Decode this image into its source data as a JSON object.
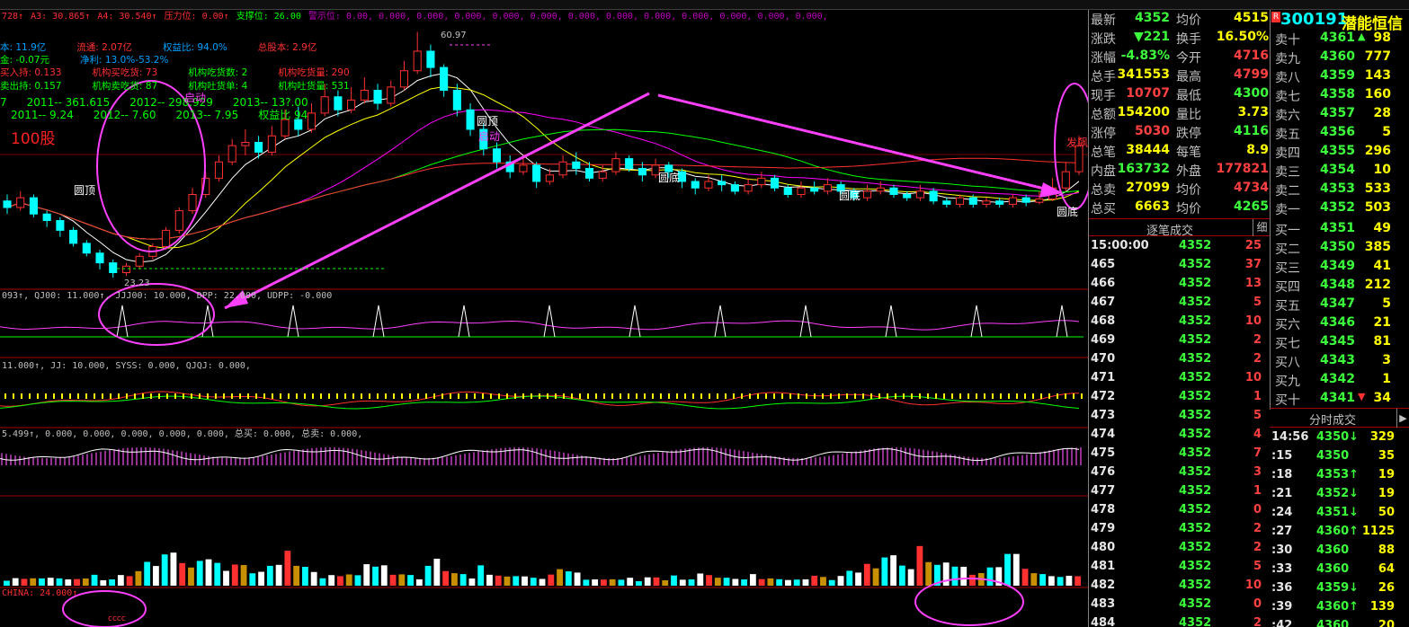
{
  "header_strip": {
    "items": [
      {
        "text": "728↑",
        "color": "#ff3030"
      },
      {
        "text": "A3: 30.865↑",
        "color": "#ff3030"
      },
      {
        "text": "A4: 30.540↑",
        "color": "#ff3030"
      },
      {
        "text": "压力位: 0.00↑",
        "color": "#ff3030"
      },
      {
        "text": "支撑位: 26.00",
        "color": "#00ff00"
      },
      {
        "text": "警示位: 0.00, 0.000, 0.000, 0.000, 0.000, 0.000, 0.000, 0.000, 0.000, 0.000, 0.000, 0.000, 0.000,",
        "color": "#c000c0"
      }
    ]
  },
  "info_overlay": {
    "r1": [
      {
        "text": "本: 11.9亿",
        "color": "#00a0ff"
      },
      {
        "text": "流通: 2.07亿",
        "color": "#ff3030"
      },
      {
        "text": "权益比: 94.0%",
        "color": "#00a0ff"
      },
      {
        "text": "总股本: 2.9亿",
        "color": "#ff3030"
      }
    ],
    "r2": [
      {
        "text": "金: -0.07元",
        "color": "#00ff00"
      },
      {
        "text": "净利: 13.0%-53.2%",
        "color": "#00a0ff"
      }
    ],
    "r3": [
      {
        "text": "买入持: 0.133",
        "color": "#ff3030"
      },
      {
        "text": "机构买吃货: 73",
        "color": "#ff3030"
      },
      {
        "text": "机构吃货数: 2",
        "color": "#00ff00"
      },
      {
        "text": "机构吃货量: 290",
        "color": "#ff3030"
      }
    ],
    "r4": [
      {
        "text": "卖出持: 0.157",
        "color": "#00ff00"
      },
      {
        "text": "机构卖吃货: 87",
        "color": "#00ff00"
      },
      {
        "text": "机构吐货单: 4",
        "color": "#00ff00"
      },
      {
        "text": "机构吐货量: 531",
        "color": "#00ff00"
      }
    ],
    "r5": [
      {
        "text": "7",
        "color": "#00ff00"
      },
      {
        "text": "2011-- 361.615",
        "color": "#00ff00"
      },
      {
        "text": "2012-- 298.929",
        "color": "#00ff00"
      },
      {
        "text": "2013-- 13?.00",
        "color": "#00ff00"
      }
    ],
    "r6": [
      {
        "text": "2011-- 9.24",
        "color": "#00ff00"
      },
      {
        "text": "2012-- 7.60",
        "color": "#00ff00"
      },
      {
        "text": "2013-- 7.95",
        "color": "#00ff00"
      },
      {
        "text": "权益比 94",
        "color": "#00ff00"
      }
    ],
    "big": {
      "text": "100股",
      "color": "#ff2020"
    },
    "peak_label": "60.97",
    "low_label": "23.23"
  },
  "price_annotations": {
    "arc_top": "圆顶",
    "arc_left": "圆顶",
    "arc_mid": "圆底",
    "arc_r1": "圆底",
    "arc_r2": "圆底",
    "start_left": "启动",
    "start_mid": "启动",
    "right_signal": "发飙"
  },
  "indicator_lines": {
    "ind1": "093↑, QJ00: 11.000↑, JJJ00: 10.000, DPP: 22.000, UDPP: -0.000",
    "ind2": "11.000↑, JJ: 10.000, SYSS: 0.000, QJQJ: 0.000,",
    "ind3": "5.499↑, 0.000, 0.000, 0.000, 0.000, 0.000, 总买: 0.000, 总卖: 0.000,",
    "ind4": "CHINA: 24.000↑",
    "ind4b": "cccc"
  },
  "quote": {
    "rows": [
      {
        "l1": "最新",
        "v1": "4352",
        "c1": "#3cff3c",
        "l2": "均价",
        "v2": "4515",
        "c2": "#ffff00"
      },
      {
        "l1": "涨跌",
        "v1": "▼221",
        "c1": "#3cff3c",
        "l2": "换手",
        "v2": "16.50%",
        "c2": "#ffff00"
      },
      {
        "l1": "涨幅",
        "v1": "-4.83%",
        "c1": "#3cff3c",
        "l2": "今开",
        "v2": "4716",
        "c2": "#ff4040"
      },
      {
        "l1": "总手",
        "v1": "341553",
        "c1": "#ffff00",
        "l2": "最高",
        "v2": "4799",
        "c2": "#ff4040"
      },
      {
        "l1": "现手",
        "v1": "10707",
        "c1": "#ff4040",
        "l2": "最低",
        "v2": "4300",
        "c2": "#3cff3c"
      },
      {
        "l1": "总额",
        "v1": "154200",
        "c1": "#ffff00",
        "l2": "量比",
        "v2": "3.73",
        "c2": "#ffff00"
      },
      {
        "l1": "涨停",
        "v1": "5030",
        "c1": "#ff4040",
        "l2": "跌停",
        "v2": "4116",
        "c2": "#3cff3c"
      },
      {
        "l1": "总笔",
        "v1": "38444",
        "c1": "#ffff00",
        "l2": "每笔",
        "v2": "8.9",
        "c2": "#ffff00"
      },
      {
        "l1": "内盘",
        "v1": "163732",
        "c1": "#3cff3c",
        "l2": "外盘",
        "v2": "177821",
        "c2": "#ff4040"
      },
      {
        "l1": "总卖",
        "v1": "27099",
        "c1": "#ffff00",
        "l2": "均价",
        "v2": "4734",
        "c2": "#ff4040"
      },
      {
        "l1": "总买",
        "v1": "6663",
        "c1": "#ffff00",
        "l2": "均价",
        "v2": "4265",
        "c2": "#3cff3c"
      }
    ]
  },
  "stock": {
    "code": "300191",
    "name": "潜能恒信",
    "badge": "R"
  },
  "order_book": {
    "rows": [
      {
        "label": "卖十",
        "price": "4361",
        "vol": "98",
        "color": "#3cff3c",
        "arrow": "▲"
      },
      {
        "label": "卖九",
        "price": "4360",
        "vol": "777",
        "color": "#3cff3c",
        "arrow": ""
      },
      {
        "label": "卖八",
        "price": "4359",
        "vol": "143",
        "color": "#3cff3c",
        "arrow": ""
      },
      {
        "label": "卖七",
        "price": "4358",
        "vol": "160",
        "color": "#3cff3c",
        "arrow": ""
      },
      {
        "label": "卖六",
        "price": "4357",
        "vol": "28",
        "color": "#3cff3c",
        "arrow": ""
      },
      {
        "label": "卖五",
        "price": "4356",
        "vol": "5",
        "color": "#3cff3c",
        "arrow": ""
      },
      {
        "label": "卖四",
        "price": "4355",
        "vol": "296",
        "color": "#3cff3c",
        "arrow": ""
      },
      {
        "label": "卖三",
        "price": "4354",
        "vol": "10",
        "color": "#3cff3c",
        "arrow": ""
      },
      {
        "label": "卖二",
        "price": "4353",
        "vol": "533",
        "color": "#3cff3c",
        "arrow": ""
      },
      {
        "label": "卖一",
        "price": "4352",
        "vol": "503",
        "color": "#3cff3c",
        "arrow": ""
      },
      {
        "label": "买一",
        "price": "4351",
        "vol": "49",
        "color": "#3cff3c",
        "arrow": ""
      },
      {
        "label": "买二",
        "price": "4350",
        "vol": "385",
        "color": "#3cff3c",
        "arrow": ""
      },
      {
        "label": "买三",
        "price": "4349",
        "vol": "41",
        "color": "#3cff3c",
        "arrow": ""
      },
      {
        "label": "买四",
        "price": "4348",
        "vol": "212",
        "color": "#3cff3c",
        "arrow": ""
      },
      {
        "label": "买五",
        "price": "4347",
        "vol": "5",
        "color": "#3cff3c",
        "arrow": ""
      },
      {
        "label": "买六",
        "price": "4346",
        "vol": "21",
        "color": "#3cff3c",
        "arrow": ""
      },
      {
        "label": "买七",
        "price": "4345",
        "vol": "81",
        "color": "#3cff3c",
        "arrow": ""
      },
      {
        "label": "买八",
        "price": "4343",
        "vol": "3",
        "color": "#3cff3c",
        "arrow": ""
      },
      {
        "label": "买九",
        "price": "4342",
        "vol": "1",
        "color": "#3cff3c",
        "arrow": ""
      },
      {
        "label": "买十",
        "price": "4341",
        "vol": "34",
        "color": "#3cff3c",
        "arrow": "▼"
      }
    ]
  },
  "tick_panel": {
    "title": "逐笔成交",
    "btn": "细",
    "rows": [
      {
        "seq": "15:00:00",
        "price": "4352",
        "vol": "25"
      },
      {
        "seq": "465",
        "price": "4352",
        "vol": "37"
      },
      {
        "seq": "466",
        "price": "4352",
        "vol": "13"
      },
      {
        "seq": "467",
        "price": "4352",
        "vol": "5"
      },
      {
        "seq": "468",
        "price": "4352",
        "vol": "10"
      },
      {
        "seq": "469",
        "price": "4352",
        "vol": "2"
      },
      {
        "seq": "470",
        "price": "4352",
        "vol": "2"
      },
      {
        "seq": "471",
        "price": "4352",
        "vol": "10"
      },
      {
        "seq": "472",
        "price": "4352",
        "vol": "1"
      },
      {
        "seq": "473",
        "price": "4352",
        "vol": "5"
      },
      {
        "seq": "474",
        "price": "4352",
        "vol": "4"
      },
      {
        "seq": "475",
        "price": "4352",
        "vol": "7"
      },
      {
        "seq": "476",
        "price": "4352",
        "vol": "3"
      },
      {
        "seq": "477",
        "price": "4352",
        "vol": "1"
      },
      {
        "seq": "478",
        "price": "4352",
        "vol": "0"
      },
      {
        "seq": "479",
        "price": "4352",
        "vol": "2"
      },
      {
        "seq": "480",
        "price": "4352",
        "vol": "2"
      },
      {
        "seq": "481",
        "price": "4352",
        "vol": "5"
      },
      {
        "seq": "482",
        "price": "4352",
        "vol": "10"
      },
      {
        "seq": "483",
        "price": "4352",
        "vol": "0"
      },
      {
        "seq": "484",
        "price": "4352",
        "vol": "2"
      }
    ]
  },
  "trade_panel": {
    "title": "分时成交",
    "btn": "▶",
    "rows": [
      {
        "time": "14:56",
        "price": "4350",
        "arrow": "↓",
        "vol": "329"
      },
      {
        "time": ":15",
        "price": "4350",
        "arrow": "",
        "vol": "35"
      },
      {
        "time": ":18",
        "price": "4353",
        "arrow": "↑",
        "vol": "19"
      },
      {
        "time": ":21",
        "price": "4352",
        "arrow": "↓",
        "vol": "19"
      },
      {
        "time": ":24",
        "price": "4351",
        "arrow": "↓",
        "vol": "50"
      },
      {
        "time": ":27",
        "price": "4360",
        "arrow": "↑",
        "vol": "1125"
      },
      {
        "time": ":30",
        "price": "4360",
        "arrow": "",
        "vol": "88"
      },
      {
        "time": ":33",
        "price": "4360",
        "arrow": "",
        "vol": "64"
      },
      {
        "time": ":36",
        "price": "4359",
        "arrow": "↓",
        "vol": "26"
      },
      {
        "time": ":39",
        "price": "4360",
        "arrow": "↑",
        "vol": "139"
      },
      {
        "time": ":42",
        "price": "4360",
        "arrow": "",
        "vol": "20"
      }
    ]
  },
  "colors": {
    "up": "#ff3030",
    "down": "#00ffff",
    "ma5": "#ffffff",
    "ma10": "#ffff00",
    "ma20": "#ff00ff",
    "ma30": "#00ff00",
    "ma60": "#ff3030",
    "annotation": "#ff40ff",
    "divider": "#a00000"
  },
  "chart_data": {
    "type": "candlestick",
    "price_ylim": [
      22,
      62
    ],
    "candles": [
      {
        "o": 35.0,
        "c": 34.0,
        "h": 36.0,
        "l": 33.0
      },
      {
        "o": 34.0,
        "c": 35.5,
        "h": 36.5,
        "l": 33.5
      },
      {
        "o": 35.5,
        "c": 33.0,
        "h": 36.0,
        "l": 32.5
      },
      {
        "o": 33.0,
        "c": 32.0,
        "h": 33.5,
        "l": 31.0
      },
      {
        "o": 32.0,
        "c": 30.5,
        "h": 32.5,
        "l": 29.5
      },
      {
        "o": 30.5,
        "c": 28.5,
        "h": 31.0,
        "l": 28.0
      },
      {
        "o": 28.5,
        "c": 27.0,
        "h": 29.0,
        "l": 26.5
      },
      {
        "o": 27.0,
        "c": 25.5,
        "h": 27.5,
        "l": 24.5
      },
      {
        "o": 25.5,
        "c": 24.0,
        "h": 26.0,
        "l": 23.23
      },
      {
        "o": 24.0,
        "c": 25.0,
        "h": 25.5,
        "l": 23.5
      },
      {
        "o": 25.0,
        "c": 26.5,
        "h": 27.0,
        "l": 24.5
      },
      {
        "o": 26.5,
        "c": 28.0,
        "h": 28.5,
        "l": 26.0
      },
      {
        "o": 28.0,
        "c": 30.5,
        "h": 31.0,
        "l": 27.5
      },
      {
        "o": 30.5,
        "c": 33.5,
        "h": 34.0,
        "l": 30.0
      },
      {
        "o": 33.5,
        "c": 36.0,
        "h": 37.0,
        "l": 33.0
      },
      {
        "o": 36.0,
        "c": 38.5,
        "h": 39.5,
        "l": 35.5
      },
      {
        "o": 38.5,
        "c": 41.0,
        "h": 42.0,
        "l": 38.0
      },
      {
        "o": 41.0,
        "c": 43.5,
        "h": 44.5,
        "l": 40.5
      },
      {
        "o": 43.5,
        "c": 44.0,
        "h": 46.0,
        "l": 42.0
      },
      {
        "o": 44.0,
        "c": 42.5,
        "h": 45.0,
        "l": 41.5
      },
      {
        "o": 42.5,
        "c": 45.0,
        "h": 46.5,
        "l": 42.0
      },
      {
        "o": 45.0,
        "c": 47.5,
        "h": 49.0,
        "l": 44.5
      },
      {
        "o": 47.5,
        "c": 46.0,
        "h": 49.5,
        "l": 45.0
      },
      {
        "o": 46.0,
        "c": 48.5,
        "h": 50.0,
        "l": 45.5
      },
      {
        "o": 48.5,
        "c": 51.0,
        "h": 53.0,
        "l": 48.0
      },
      {
        "o": 51.0,
        "c": 49.0,
        "h": 52.0,
        "l": 48.0
      },
      {
        "o": 49.0,
        "c": 50.5,
        "h": 52.5,
        "l": 48.5
      },
      {
        "o": 50.5,
        "c": 52.0,
        "h": 54.0,
        "l": 50.0
      },
      {
        "o": 52.0,
        "c": 50.0,
        "h": 53.0,
        "l": 49.0
      },
      {
        "o": 50.0,
        "c": 52.5,
        "h": 53.5,
        "l": 49.5
      },
      {
        "o": 52.5,
        "c": 55.0,
        "h": 56.5,
        "l": 52.0
      },
      {
        "o": 55.0,
        "c": 58.0,
        "h": 60.97,
        "l": 54.5
      },
      {
        "o": 58.0,
        "c": 55.5,
        "h": 59.0,
        "l": 54.0
      },
      {
        "o": 55.5,
        "c": 52.0,
        "h": 56.0,
        "l": 51.0
      },
      {
        "o": 52.0,
        "c": 49.0,
        "h": 53.0,
        "l": 48.0
      },
      {
        "o": 49.0,
        "c": 46.0,
        "h": 50.0,
        "l": 45.0
      },
      {
        "o": 46.0,
        "c": 43.0,
        "h": 47.0,
        "l": 42.0
      },
      {
        "o": 43.0,
        "c": 41.0,
        "h": 44.0,
        "l": 40.0
      },
      {
        "o": 41.0,
        "c": 39.5,
        "h": 42.0,
        "l": 38.5
      },
      {
        "o": 39.5,
        "c": 40.5,
        "h": 41.5,
        "l": 39.0
      },
      {
        "o": 40.5,
        "c": 38.0,
        "h": 41.0,
        "l": 37.0
      },
      {
        "o": 38.0,
        "c": 39.0,
        "h": 40.0,
        "l": 37.5
      },
      {
        "o": 39.0,
        "c": 41.0,
        "h": 42.0,
        "l": 38.5
      },
      {
        "o": 41.0,
        "c": 40.0,
        "h": 42.5,
        "l": 39.0
      },
      {
        "o": 40.0,
        "c": 38.5,
        "h": 41.0,
        "l": 38.0
      },
      {
        "o": 38.5,
        "c": 39.5,
        "h": 40.5,
        "l": 38.0
      },
      {
        "o": 39.5,
        "c": 41.5,
        "h": 42.5,
        "l": 39.0
      },
      {
        "o": 41.5,
        "c": 40.0,
        "h": 42.0,
        "l": 39.5
      },
      {
        "o": 40.0,
        "c": 39.0,
        "h": 41.0,
        "l": 38.0
      },
      {
        "o": 39.0,
        "c": 40.5,
        "h": 41.5,
        "l": 38.5
      },
      {
        "o": 40.5,
        "c": 39.5,
        "h": 41.0,
        "l": 38.5
      },
      {
        "o": 39.5,
        "c": 38.0,
        "h": 40.0,
        "l": 37.0
      },
      {
        "o": 38.0,
        "c": 37.0,
        "h": 38.5,
        "l": 36.0
      },
      {
        "o": 37.0,
        "c": 38.0,
        "h": 39.0,
        "l": 36.5
      },
      {
        "o": 38.0,
        "c": 37.5,
        "h": 39.0,
        "l": 36.5
      },
      {
        "o": 37.5,
        "c": 36.5,
        "h": 38.0,
        "l": 36.0
      },
      {
        "o": 36.5,
        "c": 37.5,
        "h": 38.5,
        "l": 36.0
      },
      {
        "o": 37.5,
        "c": 38.5,
        "h": 39.5,
        "l": 37.0
      },
      {
        "o": 38.5,
        "c": 37.0,
        "h": 39.0,
        "l": 36.5
      },
      {
        "o": 37.0,
        "c": 36.0,
        "h": 37.5,
        "l": 35.5
      },
      {
        "o": 36.0,
        "c": 37.0,
        "h": 38.0,
        "l": 35.5
      },
      {
        "o": 37.0,
        "c": 36.5,
        "h": 38.0,
        "l": 36.0
      },
      {
        "o": 36.5,
        "c": 37.5,
        "h": 38.5,
        "l": 36.0
      },
      {
        "o": 37.5,
        "c": 36.5,
        "h": 38.0,
        "l": 36.0
      },
      {
        "o": 36.5,
        "c": 35.5,
        "h": 37.0,
        "l": 35.0
      },
      {
        "o": 35.5,
        "c": 36.5,
        "h": 37.5,
        "l": 35.0
      },
      {
        "o": 36.5,
        "c": 37.0,
        "h": 38.0,
        "l": 36.0
      },
      {
        "o": 37.0,
        "c": 36.0,
        "h": 37.5,
        "l": 35.5
      },
      {
        "o": 36.0,
        "c": 35.5,
        "h": 36.5,
        "l": 35.0
      },
      {
        "o": 35.5,
        "c": 36.5,
        "h": 37.5,
        "l": 35.0
      },
      {
        "o": 36.5,
        "c": 35.0,
        "h": 37.0,
        "l": 34.5
      },
      {
        "o": 35.0,
        "c": 34.5,
        "h": 35.5,
        "l": 34.0
      },
      {
        "o": 34.5,
        "c": 35.5,
        "h": 36.0,
        "l": 34.0
      },
      {
        "o": 35.5,
        "c": 34.5,
        "h": 36.0,
        "l": 34.0
      },
      {
        "o": 34.5,
        "c": 35.0,
        "h": 35.5,
        "l": 34.0
      },
      {
        "o": 35.0,
        "c": 34.5,
        "h": 35.5,
        "l": 34.0
      },
      {
        "o": 34.5,
        "c": 35.5,
        "h": 36.0,
        "l": 34.0
      },
      {
        "o": 35.5,
        "c": 34.8,
        "h": 36.0,
        "l": 34.2
      },
      {
        "o": 34.8,
        "c": 35.3,
        "h": 36.5,
        "l": 34.5
      },
      {
        "o": 35.3,
        "c": 37.0,
        "h": 38.5,
        "l": 35.0
      },
      {
        "o": 37.0,
        "c": 39.5,
        "h": 41.0,
        "l": 36.5
      },
      {
        "o": 39.5,
        "c": 43.52,
        "h": 45.0,
        "l": 39.0
      }
    ],
    "volume": {
      "ylim": [
        0,
        100
      ],
      "values": [
        10,
        12,
        9,
        14,
        11,
        10,
        13,
        9,
        8,
        12,
        15,
        11,
        10,
        14,
        18,
        22,
        30,
        35,
        45,
        40,
        38,
        25,
        50,
        42,
        30,
        28,
        32,
        26,
        22,
        20,
        24,
        35,
        48,
        40,
        30,
        18,
        14,
        16,
        12,
        20,
        15,
        26,
        32,
        28,
        22,
        18,
        14,
        12,
        30,
        34,
        26,
        18,
        14,
        12,
        28,
        22,
        16,
        12,
        18,
        14,
        10,
        12,
        16,
        20,
        24,
        18,
        12,
        10,
        8,
        12,
        9,
        10,
        8,
        12,
        10,
        9,
        14,
        12,
        10,
        16,
        20,
        12
      ]
    }
  }
}
